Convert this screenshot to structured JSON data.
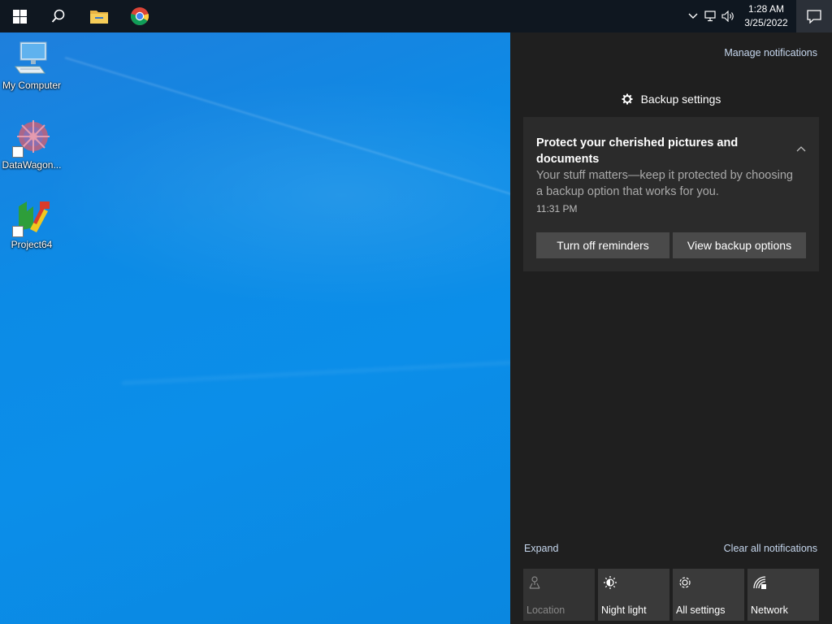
{
  "taskbar": {
    "clock_time": "1:28 AM",
    "clock_date": "3/25/2022",
    "icons": [
      "windows-start-icon",
      "search-icon",
      "file-explorer-icon",
      "chrome-icon",
      "chevron-up-icon",
      "network-icon",
      "volume-icon",
      "action-center-icon"
    ]
  },
  "desktop": {
    "icons": [
      {
        "label": "My Computer",
        "icon": "computer-icon"
      },
      {
        "label": "DataWagon...",
        "icon": "datawagon-icon"
      },
      {
        "label": "Project64",
        "icon": "project64-icon"
      }
    ]
  },
  "action_center": {
    "manage_label": "Manage notifications",
    "group_title": "Backup settings",
    "notification": {
      "title": "Protect your cherished pictures and documents",
      "body": "Your stuff matters—keep it protected by choosing a backup option that works for you.",
      "time": "11:31 PM",
      "button1": "Turn off reminders",
      "button2": "View backup options"
    },
    "expand_label": "Expand",
    "clear_label": "Clear all notifications",
    "tiles": [
      {
        "label": "Location",
        "icon": "location-icon",
        "enabled": false
      },
      {
        "label": "Night light",
        "icon": "night-light-icon",
        "enabled": true
      },
      {
        "label": "All settings",
        "icon": "gear-icon",
        "enabled": true
      },
      {
        "label": "Network",
        "icon": "network-icon",
        "enabled": true
      }
    ]
  },
  "colors": {
    "accent_link": "#c6d7ee",
    "panel_bg": "#1f1f1f",
    "card_bg": "#2b2b2b",
    "taskbar_bg": "#0f1720",
    "desktop_blue": "#0b8ee9"
  }
}
